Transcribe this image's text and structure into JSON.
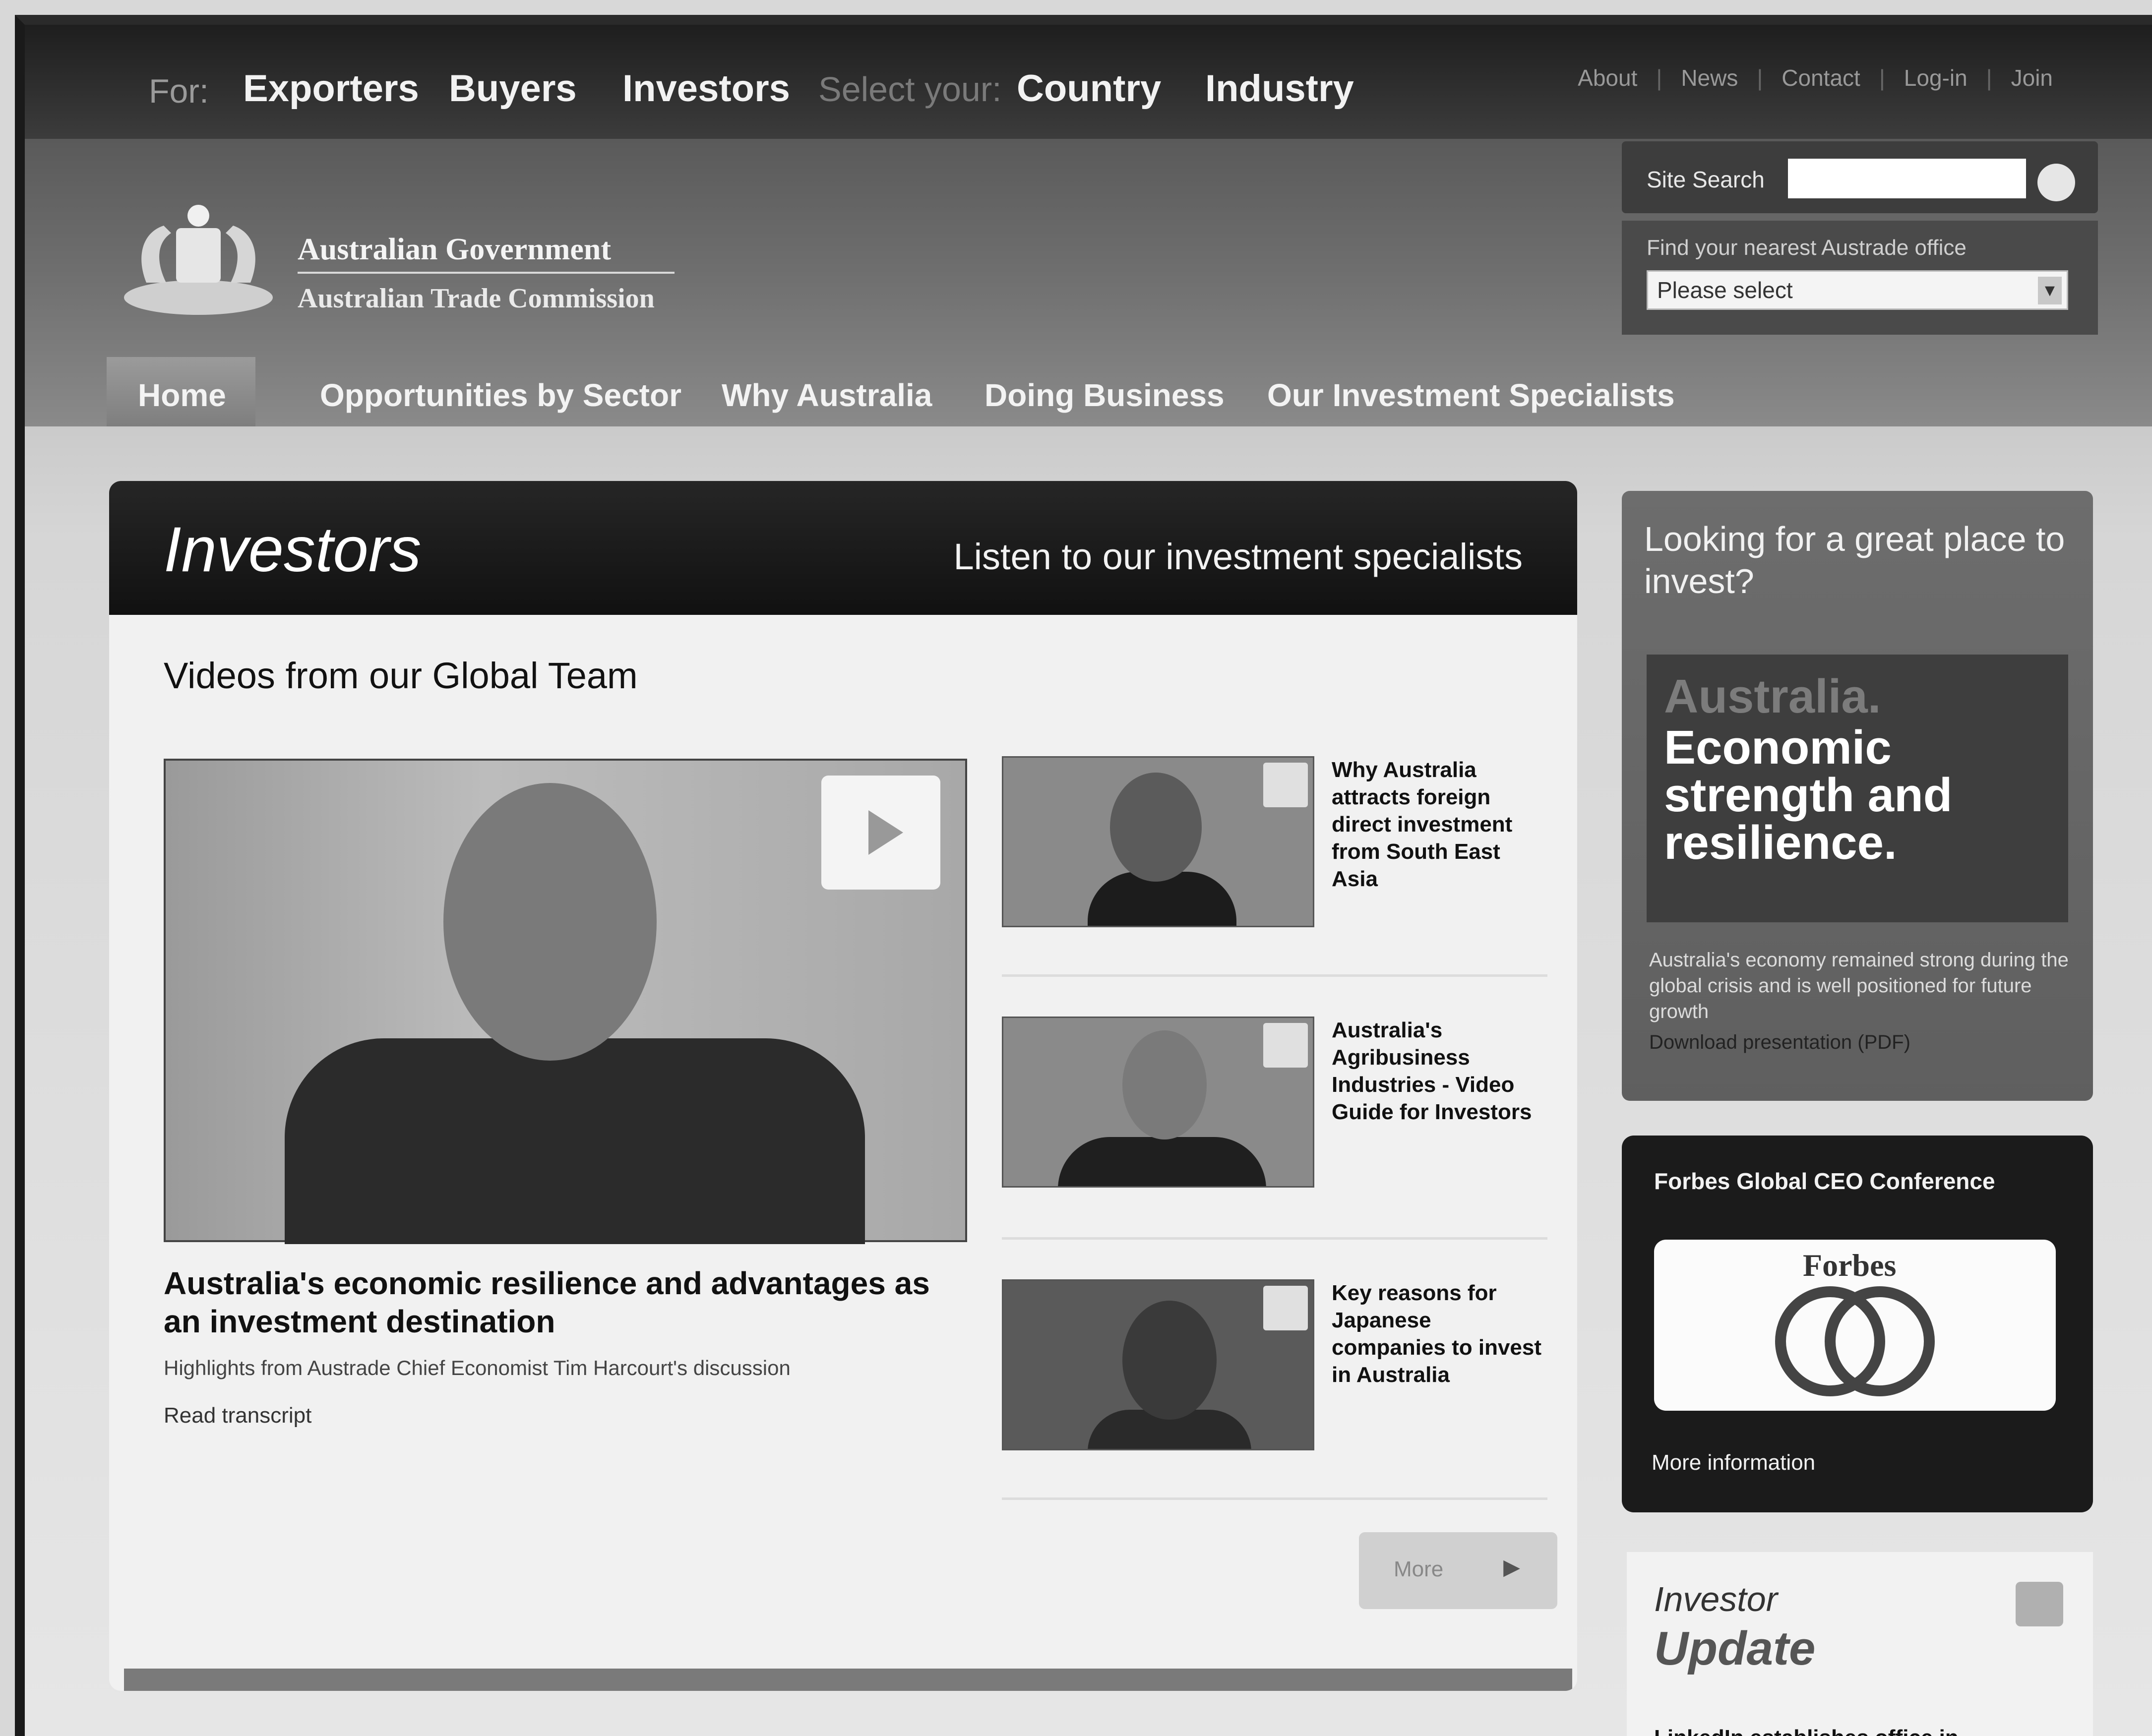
{
  "topbar": {
    "for_label": "For:",
    "audiences": [
      "Exporters",
      "Buyers",
      "Investors"
    ],
    "select_label": "Select your:",
    "selectors": [
      "Country",
      "Industry"
    ],
    "util_links": [
      "About",
      "News",
      "Contact",
      "Log-in",
      "Join"
    ]
  },
  "header": {
    "gov_title": "Australian Government",
    "gov_subtitle": "Australian Trade Commission",
    "search_label": "Site Search",
    "office_label": "Find your nearest Austrade office",
    "office_select": "Please select"
  },
  "mainnav": {
    "items": [
      "Home",
      "Opportunities by Sector",
      "Why Australia",
      "Doing Business",
      "Our Investment Specialists"
    ]
  },
  "panel": {
    "title": "Investors",
    "tagline": "Listen to our investment specialists",
    "videos_heading": "Videos from our Global Team",
    "featured_caption": "Australia's economic resilience and advantages as an investment destination",
    "featured_sub": "Highlights from Austrade Chief Economist Tim Harcourt's discussion",
    "read_transcript": "Read transcript",
    "thumbs": [
      {
        "text": "Why Australia attracts foreign direct investment from South East Asia"
      },
      {
        "text": "Australia's Agribusiness Industries - Video Guide for Investors"
      },
      {
        "text": "Key reasons for Japanese companies to invest in Australia"
      }
    ],
    "more_label": "More"
  },
  "sidebar": {
    "promo_lead": "Looking for a great place to invest?",
    "promo_australia": "Australia.",
    "promo_headline": "Economic strength and resilience.",
    "promo_desc": "Australia's economy remained strong during the global crisis and is well positioned for future growth",
    "promo_download": "Download presentation (PDF)",
    "forbes_header": "Forbes Global CEO Conference",
    "forbes_logo_word": "Forbes",
    "forbes_more": "More information",
    "update_line1": "Investor",
    "update_line2": "Update",
    "update_news": "LinkedIn establishes office in"
  },
  "colors": {
    "topbar_bg": "#2a2a2a",
    "panel_head_bg": "#1a1a1a",
    "forbes_bg": "#1b1b1b"
  }
}
